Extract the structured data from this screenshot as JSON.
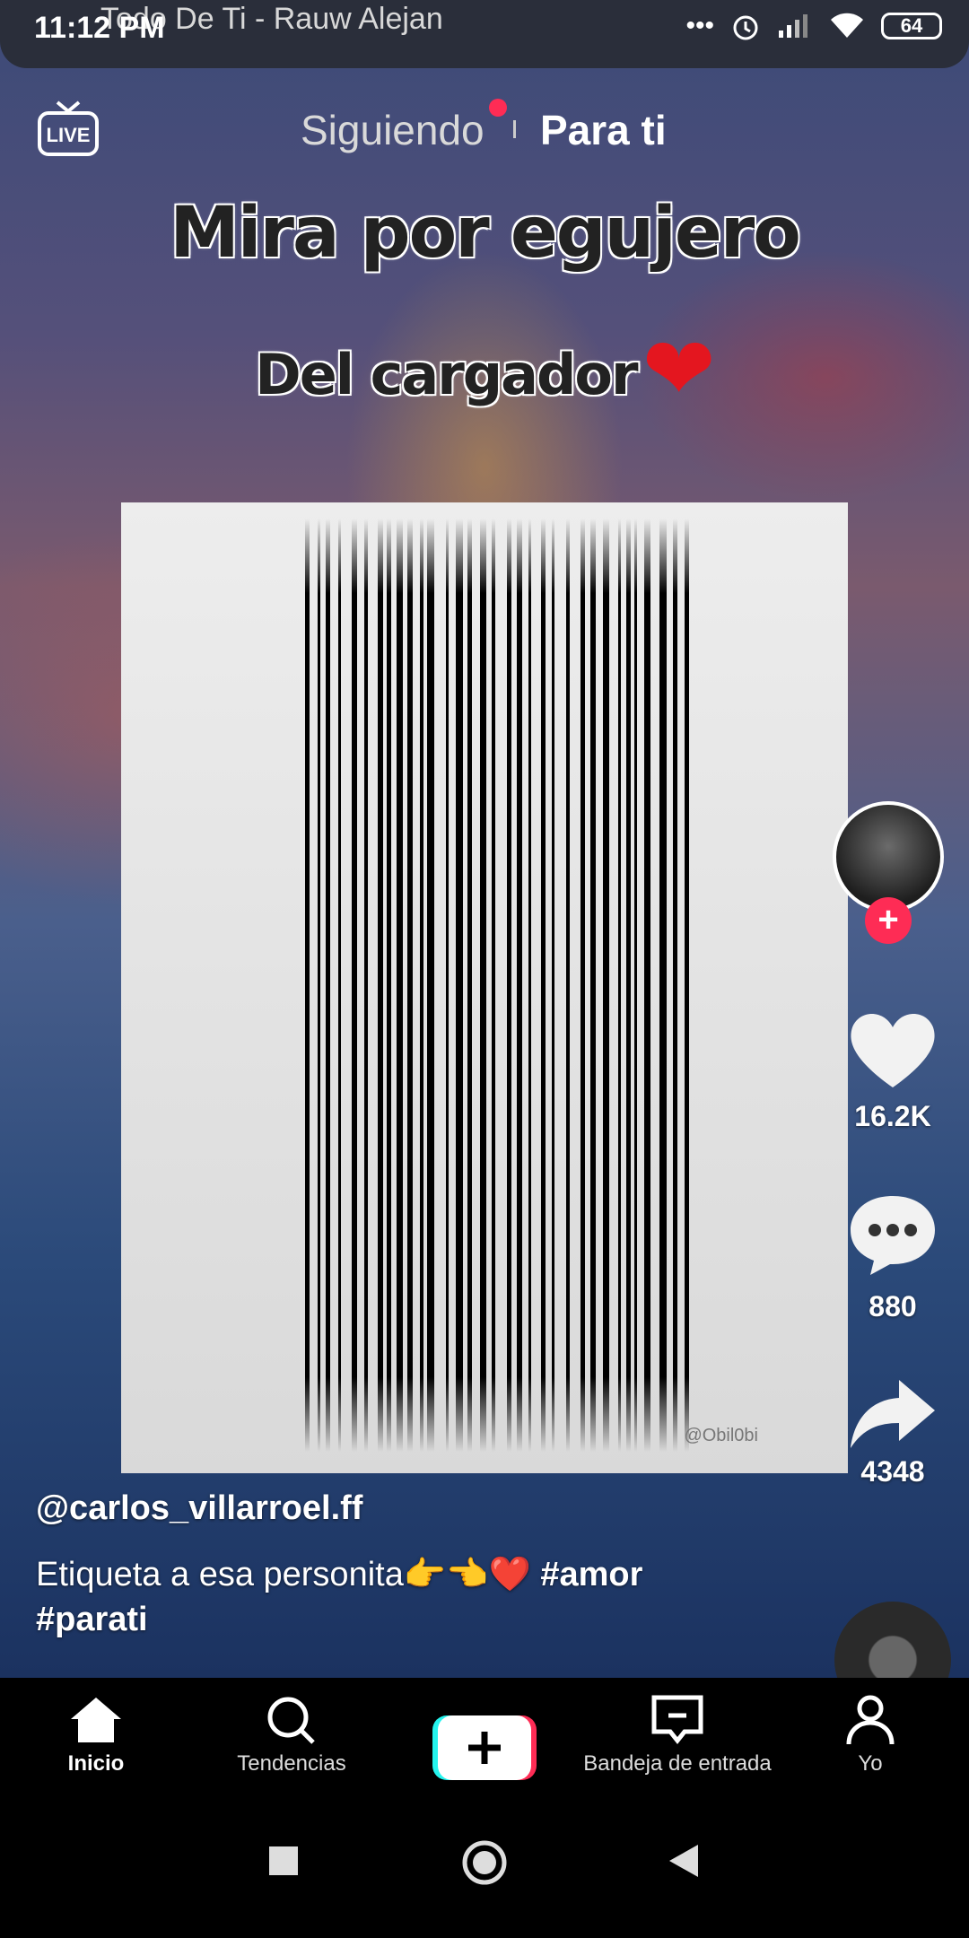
{
  "status_bar": {
    "time": "11:12 PM",
    "song": "Todo De Ti - Rauw Alejan",
    "battery": "64",
    "icons": [
      "more-dots-icon",
      "alarm-icon",
      "signal-icon",
      "wifi-icon",
      "battery-icon"
    ]
  },
  "top_nav": {
    "live_label": "LIVE",
    "tab_following": "Siguiendo",
    "tab_for_you": "Para ti"
  },
  "video": {
    "overlay_line1": "Mira por egujero",
    "overlay_line2": "Del cargador",
    "overlay_emoji": "❤",
    "watermark": "@Obil0bi"
  },
  "actions": {
    "likes": "16.2K",
    "comments": "880",
    "shares": "4348"
  },
  "post": {
    "username": "@carlos_villarroel.ff",
    "caption_text": "Etiqueta a esa personita👉👈❤️",
    "hashtag1": "#amor",
    "hashtag2": "#parati"
  },
  "bottom_nav": {
    "home": "Inicio",
    "discover": "Tendencias",
    "inbox": "Bandeja de entrada",
    "profile": "Yo"
  },
  "colors": {
    "accent": "#fe2c55",
    "cyan": "#25f4ee"
  }
}
